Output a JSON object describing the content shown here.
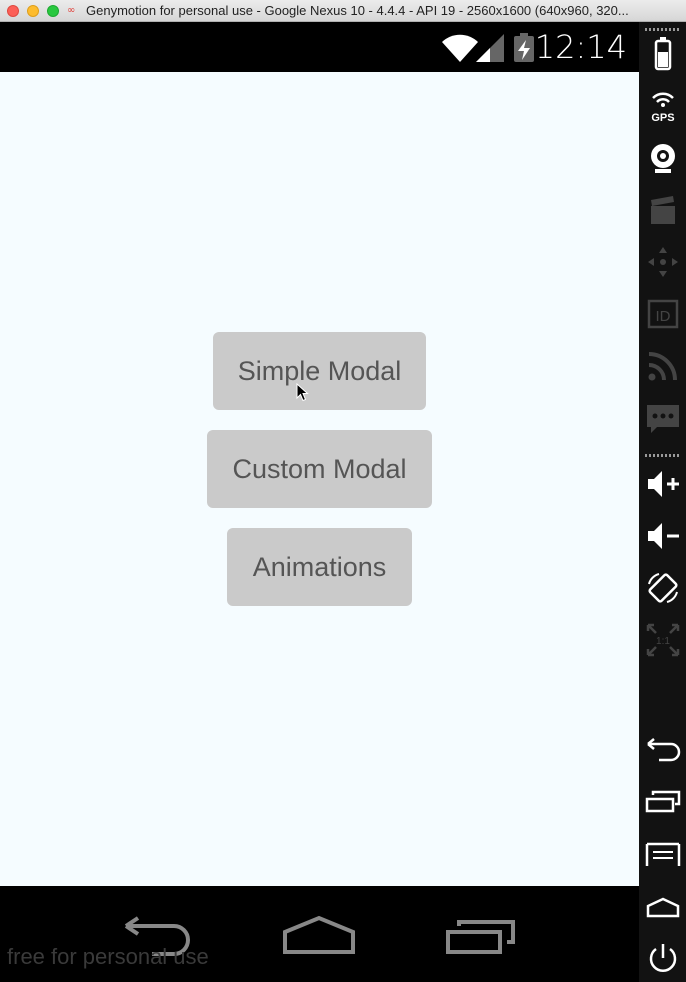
{
  "window": {
    "title": "Genymotion for personal use - Google Nexus 10 - 4.4.4 - API 19 - 2560x1600 (640x960, 320..."
  },
  "statusbar": {
    "time": "12:14",
    "icons": [
      "wifi-icon",
      "signal-icon",
      "battery-charging-icon"
    ]
  },
  "screen": {
    "buttons": [
      {
        "label": "Simple Modal"
      },
      {
        "label": "Custom Modal"
      },
      {
        "label": "Animations"
      }
    ]
  },
  "navbar": {
    "icons": [
      "back-icon",
      "home-icon",
      "recents-icon"
    ],
    "watermark": "free for personal use"
  },
  "sidebar": {
    "gps_label": "GPS",
    "id_label": "ID",
    "pixel_label": "1:1",
    "icons": [
      "battery-icon",
      "gps-icon",
      "webcam-icon",
      "capture-icon",
      "dpad-icon",
      "id-icon",
      "rss-icon",
      "sms-icon",
      "volume-up-icon",
      "volume-down-icon",
      "rotate-icon",
      "pixel-perfect-icon",
      "back-icon",
      "recents-icon",
      "menu-icon",
      "home-icon",
      "power-icon"
    ]
  },
  "colors": {
    "screen_bg": "#f5fcff",
    "button_bg": "#cacaca",
    "button_text": "#555555"
  }
}
